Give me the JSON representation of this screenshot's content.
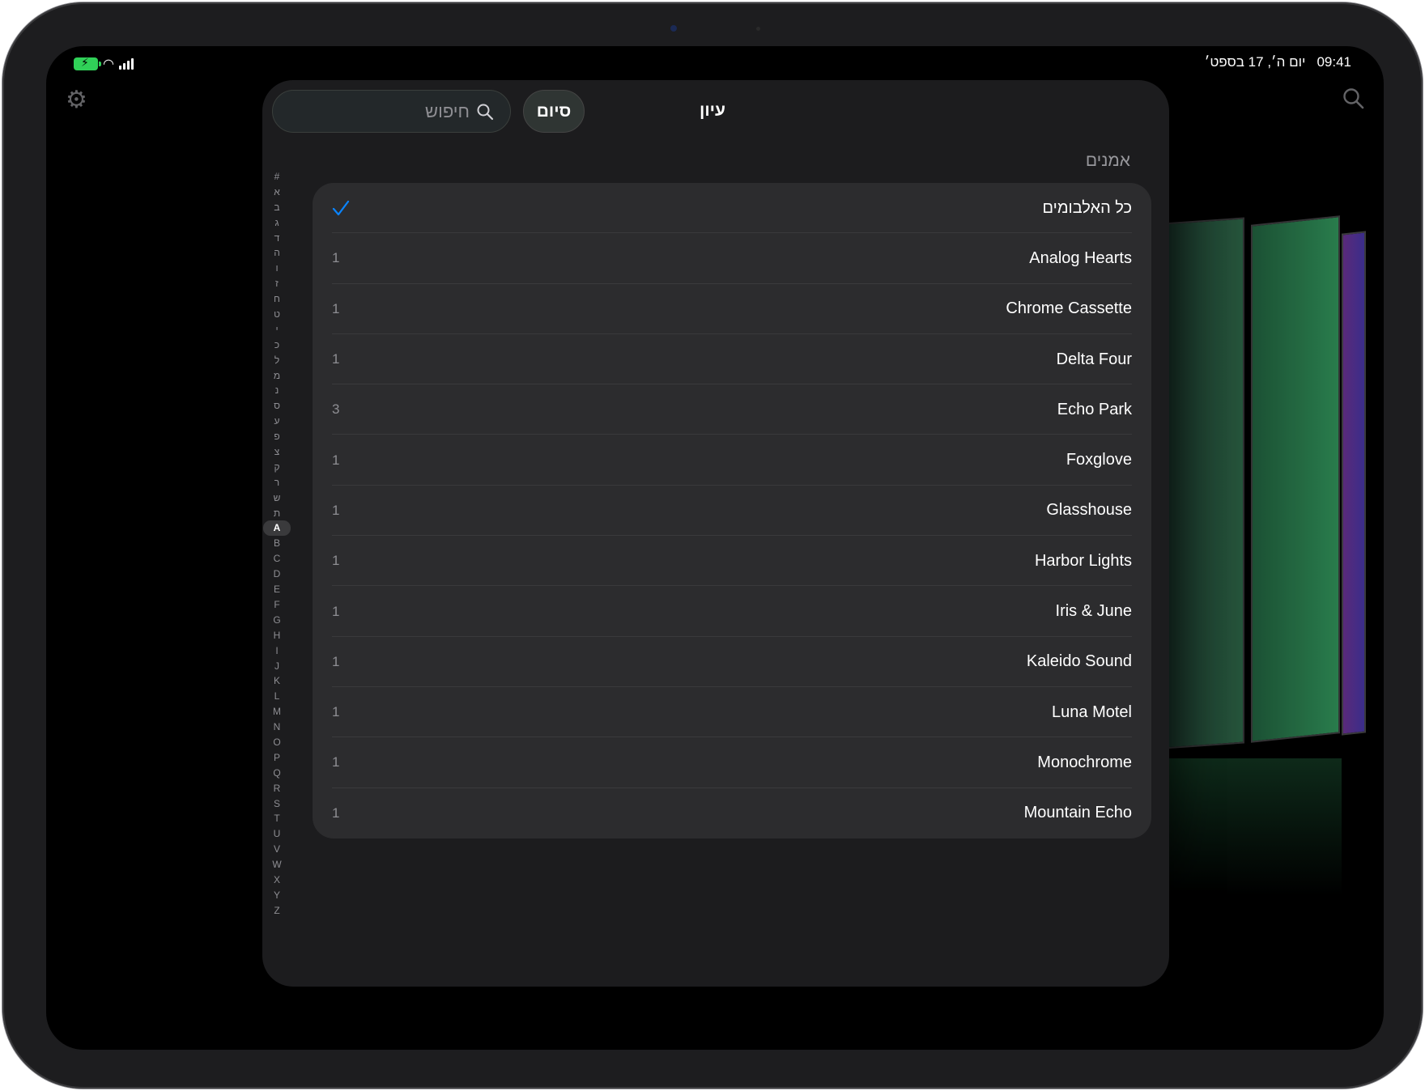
{
  "status_bar": {
    "time": "09:41",
    "date": "יום ה׳, 17 בספט׳",
    "battery_icon": "battery-charging-icon",
    "wifi_icon": "wifi-icon",
    "cell_icon": "cellular-signal-icon"
  },
  "toolbar": {
    "settings_icon": "gear-icon",
    "search_icon": "magnifier-icon"
  },
  "modal": {
    "title": "עיון",
    "done_label": "סיום",
    "search_placeholder": "חיפוש",
    "section_header": "אמנים",
    "accent_color": "#0a84ff"
  },
  "index_letters": [
    "#",
    "א",
    "ב",
    "ג",
    "ד",
    "ה",
    "ו",
    "ז",
    "ח",
    "ט",
    "י",
    "כ",
    "ל",
    "מ",
    "נ",
    "ס",
    "ע",
    "פ",
    "צ",
    "ק",
    "ר",
    "ש",
    "ת",
    "A",
    "B",
    "C",
    "D",
    "E",
    "F",
    "G",
    "H",
    "I",
    "J",
    "K",
    "L",
    "M",
    "N",
    "O",
    "P",
    "Q",
    "R",
    "S",
    "T",
    "U",
    "V",
    "W",
    "X",
    "Y",
    "Z"
  ],
  "index_active": "A",
  "artists": [
    {
      "name": "כל האלבומים",
      "count": "",
      "selected": true
    },
    {
      "name": "Analog Hearts",
      "count": "1"
    },
    {
      "name": "Chrome Cassette",
      "count": "1"
    },
    {
      "name": "Delta Four",
      "count": "1"
    },
    {
      "name": "Echo Park",
      "count": "3"
    },
    {
      "name": "Foxglove",
      "count": "1"
    },
    {
      "name": "Glasshouse",
      "count": "1"
    },
    {
      "name": "Harbor Lights",
      "count": "1"
    },
    {
      "name": "Iris & June",
      "count": "1"
    },
    {
      "name": "Kaleido Sound",
      "count": "1"
    },
    {
      "name": "Luna Motel",
      "count": "1"
    },
    {
      "name": "Monochrome",
      "count": "1"
    },
    {
      "name": "Mountain Echo",
      "count": "1"
    }
  ]
}
